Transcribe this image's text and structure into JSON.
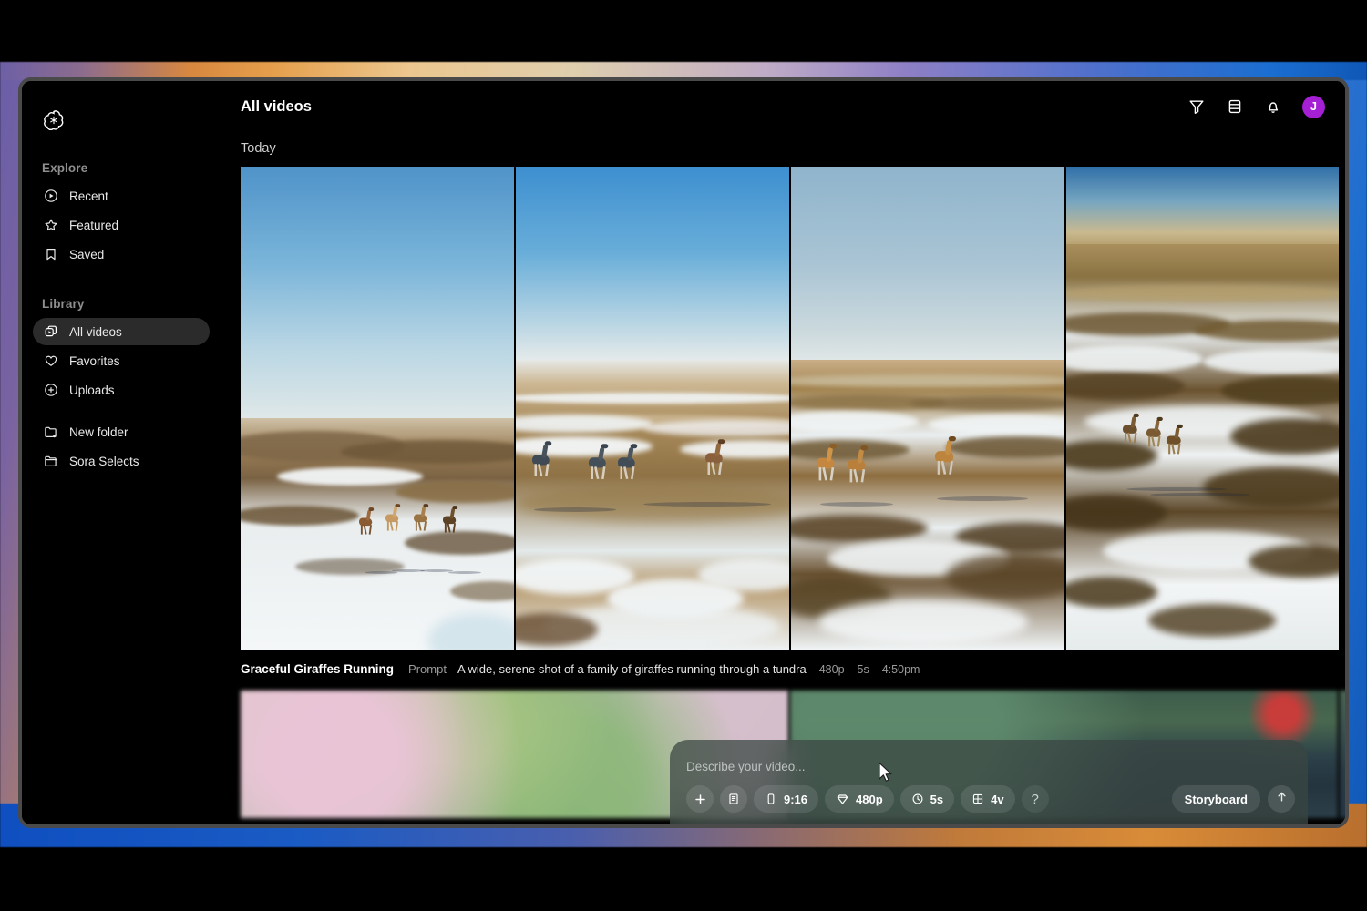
{
  "app": {
    "brand_icon": "openai-logo"
  },
  "sidebar": {
    "explore_label": "Explore",
    "library_label": "Library",
    "explore_items": [
      {
        "label": "Recent",
        "icon": "play-circle-icon"
      },
      {
        "label": "Featured",
        "icon": "star-icon"
      },
      {
        "label": "Saved",
        "icon": "bookmark-icon"
      }
    ],
    "library_items": [
      {
        "label": "All videos",
        "icon": "videos-stack-icon",
        "active": true
      },
      {
        "label": "Favorites",
        "icon": "heart-icon",
        "active": false
      },
      {
        "label": "Uploads",
        "icon": "plus-circle-icon",
        "active": false
      }
    ],
    "folder_items": [
      {
        "label": "New folder",
        "icon": "folder-plus-icon"
      },
      {
        "label": "Sora Selects",
        "icon": "folder-icon"
      }
    ]
  },
  "header": {
    "title": "All videos",
    "actions": [
      {
        "name": "filter-icon",
        "label": "Filter"
      },
      {
        "name": "layers-icon",
        "label": "Layers"
      },
      {
        "name": "notifications-icon",
        "label": "Notifications"
      }
    ],
    "avatar_initial": "J",
    "avatar_color": "#a51fd4"
  },
  "content": {
    "group_label": "Today",
    "video": {
      "title": "Graceful Giraffes Running",
      "prompt_label": "Prompt",
      "prompt": "A wide, serene shot of a family of giraffes running through a tundra",
      "resolution": "480p",
      "duration": "5s",
      "time": "4:50pm"
    }
  },
  "composer": {
    "placeholder": "Describe your video...",
    "value": "",
    "buttons": [
      {
        "name": "add-button",
        "icon": "plus-icon",
        "label": ""
      },
      {
        "name": "presets-button",
        "icon": "card-icon",
        "label": ""
      },
      {
        "name": "aspect-ratio-button",
        "icon": "phone-icon",
        "label": "9:16"
      },
      {
        "name": "resolution-button",
        "icon": "diamond-icon",
        "label": "480p"
      },
      {
        "name": "duration-button",
        "icon": "clock-icon",
        "label": "5s"
      },
      {
        "name": "variations-button",
        "icon": "grid-icon",
        "label": "4v"
      },
      {
        "name": "help-button",
        "icon": "question-icon",
        "label": "?"
      }
    ],
    "storyboard_label": "Storyboard",
    "send_icon": "arrow-up-icon"
  },
  "colors": {
    "accent": "#a51fd4",
    "window_bg": "#000000",
    "sidebar_active": "#2b2b2b"
  }
}
